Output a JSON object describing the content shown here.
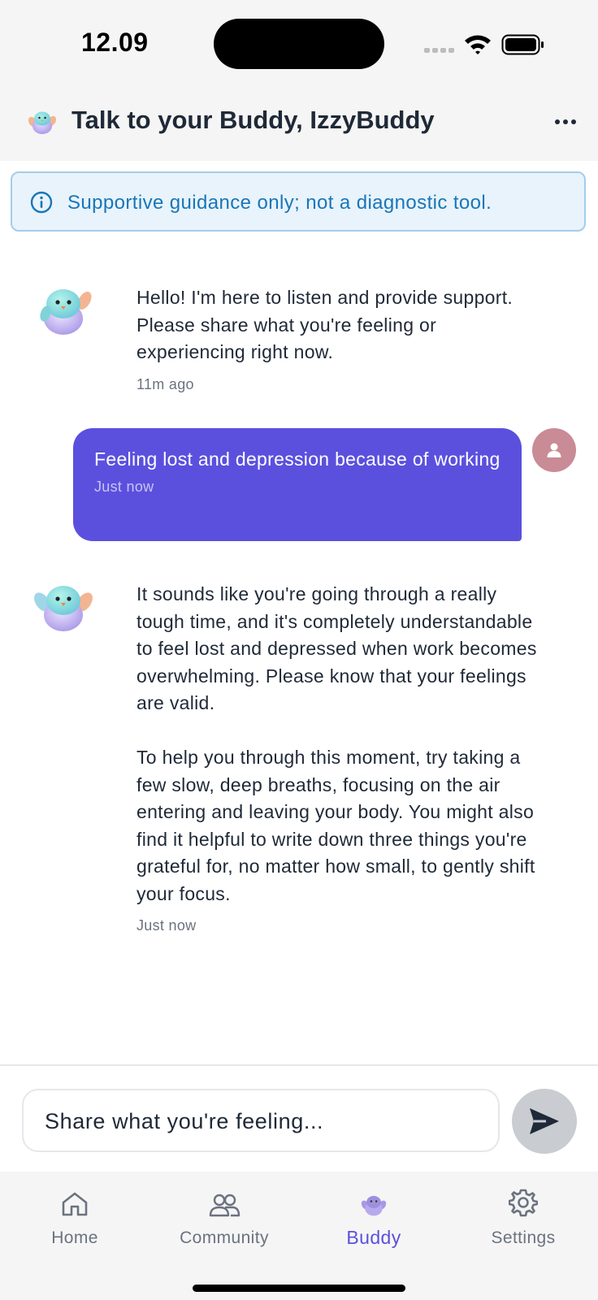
{
  "status_bar": {
    "time": "12.09"
  },
  "header": {
    "title": "Talk to your Buddy, IzzyBuddy"
  },
  "disclaimer": {
    "text": "Supportive guidance only; not a diagnostic tool."
  },
  "messages": [
    {
      "sender": "bot",
      "text": "Hello! I'm here to listen and provide support. Please share what you're feeling or experiencing right now.",
      "time": "11m ago"
    },
    {
      "sender": "user",
      "text": "Feeling lost and depression because of working",
      "time": "Just now"
    },
    {
      "sender": "bot",
      "paragraphs": [
        "It sounds like you're going through a really tough time, and it's completely understandable to feel lost and depressed when work becomes overwhelming. Please know that your feelings are valid.",
        "To help you through this moment, try taking a few slow, deep breaths, focusing on the air entering and leaving your body. You might also find it helpful to write down three things you're grateful for, no matter how small, to gently shift your focus."
      ],
      "time": "Just now"
    }
  ],
  "composer": {
    "placeholder": "Share what you're feeling..."
  },
  "tabs": [
    {
      "label": "Home",
      "icon": "home-icon",
      "active": false
    },
    {
      "label": "Community",
      "icon": "community-icon",
      "active": false
    },
    {
      "label": "Buddy",
      "icon": "buddy-icon",
      "active": true
    },
    {
      "label": "Settings",
      "icon": "gear-icon",
      "active": false
    }
  ],
  "colors": {
    "accent": "#5b50de",
    "info": "#1976b8",
    "info_bg": "#e8f3fb",
    "user_avatar": "#c98b96"
  }
}
